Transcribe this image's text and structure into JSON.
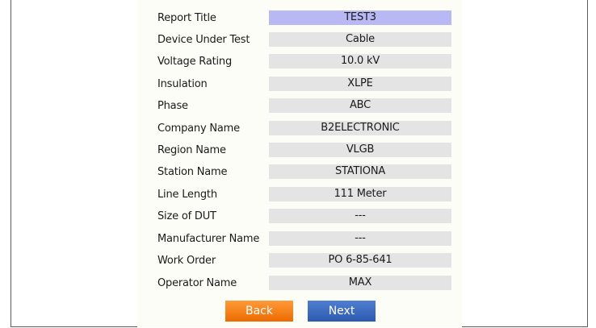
{
  "form": {
    "fields": [
      {
        "label": "Report Title",
        "value": "TEST3"
      },
      {
        "label": "Device Under Test",
        "value": "Cable"
      },
      {
        "label": "Voltage Rating",
        "value": "10.0 kV"
      },
      {
        "label": "Insulation",
        "value": "XLPE"
      },
      {
        "label": "Phase",
        "value": "ABC"
      },
      {
        "label": "Company Name",
        "value": "B2ELECTRONIC"
      },
      {
        "label": "Region Name",
        "value": "VLGB"
      },
      {
        "label": "Station Name",
        "value": "STATIONA"
      },
      {
        "label": "Line Length",
        "value": "111 Meter"
      },
      {
        "label": "Size of DUT",
        "value": "---"
      },
      {
        "label": "Manufacturer Name",
        "value": "---"
      },
      {
        "label": "Work Order",
        "value": "PO 6-85-641"
      },
      {
        "label": "Operator Name",
        "value": "MAX"
      }
    ],
    "selected_field_color": "#b8b8f4",
    "field_background_color": "#e4e4e4"
  },
  "buttons": {
    "back_label": "Back",
    "next_label": "Next",
    "back_color": "#f07a10",
    "next_color": "#3a68c0"
  }
}
